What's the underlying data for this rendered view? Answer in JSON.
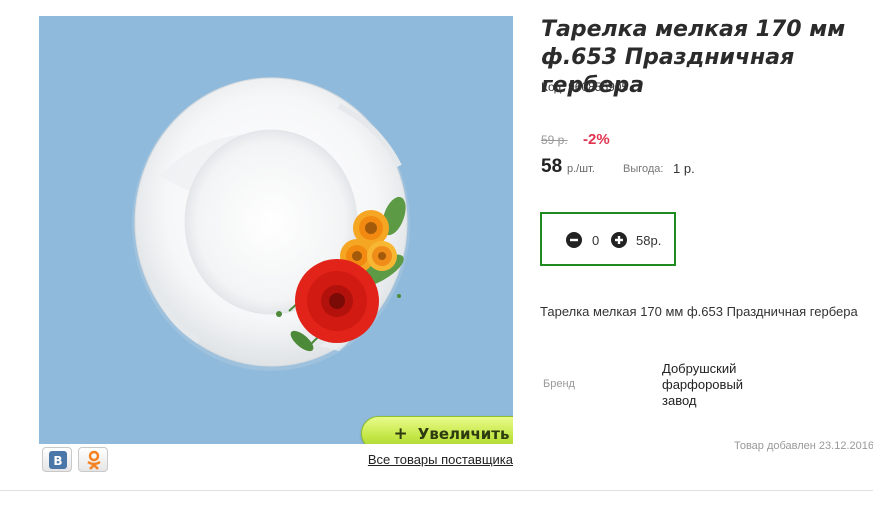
{
  "product": {
    "title": "Тарелка мелкая 170 мм ф.653 Праздничная гербера",
    "code": "Код: 960855905",
    "description": "Тарелка мелкая 170 мм ф.653 Праздничная гербера",
    "added": "Товар добавлен 23.12.2016"
  },
  "gallery": {
    "image_icon": "plate-photo",
    "zoom_label": "Увеличить",
    "zoom_icon": "plus-icon"
  },
  "price": {
    "old": "59 р.",
    "discount": "-2%",
    "current": "58",
    "unit": "р./шт.",
    "benefit_label": "Выгода:",
    "benefit_value": "1 р.",
    "discount_color": "#e0344f"
  },
  "cart": {
    "quantity": "0",
    "total": "58р.",
    "minus_icon": "minus-circle-icon",
    "plus_icon": "plus-circle-icon",
    "border_color": "#1f8a1f"
  },
  "specs": {
    "brand_label": "Бренд",
    "brand_value": "Добрушский фарфоровый завод"
  },
  "links": {
    "supplier": "Все товары поставщика"
  },
  "social": {
    "vk_icon": "vk-icon",
    "ok_icon": "odnoklassniki-icon"
  }
}
